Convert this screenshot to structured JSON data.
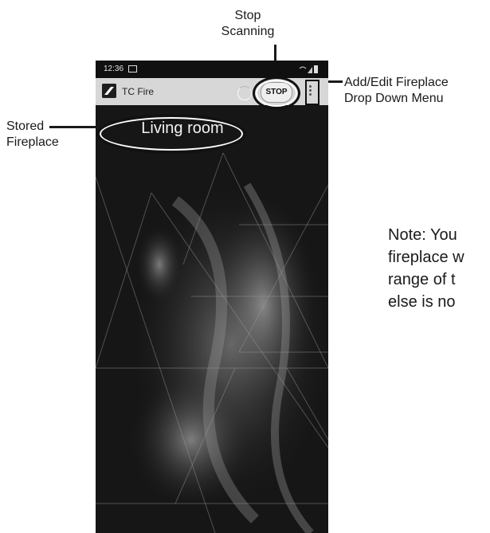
{
  "annotations": {
    "stop_scanning": [
      "Stop",
      "Scanning"
    ],
    "menu": [
      "Add/Edit Fireplace",
      "Drop Down Menu"
    ],
    "stored": [
      "Stored",
      "Fireplace"
    ],
    "note": [
      "Note: You",
      "fireplace w",
      "range of t",
      "else is no"
    ]
  },
  "phone": {
    "status_time": "12:36",
    "app_title": "TC Fire",
    "stop_label": "STOP",
    "room_name": "Living room"
  },
  "icons": [
    "image-icon",
    "wifi-icon",
    "signal-icon",
    "battery-icon",
    "app-logo-icon",
    "loading-spinner-icon",
    "more-vert-icon"
  ]
}
